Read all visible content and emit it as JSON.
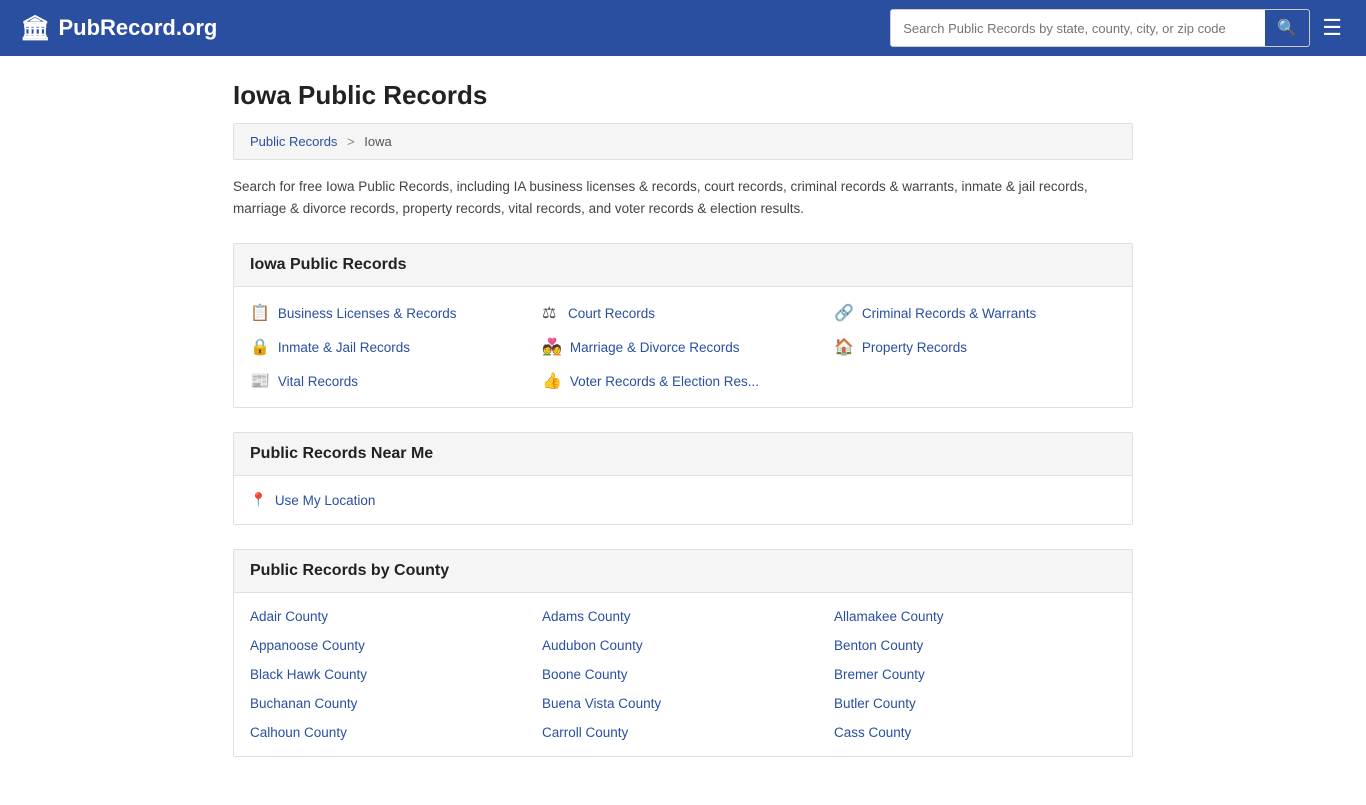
{
  "header": {
    "logo_icon": "🏛",
    "logo_text": "PubRecord.org",
    "search_placeholder": "Search Public Records by state, county, city, or zip code",
    "search_icon": "🔍",
    "menu_icon": "☰"
  },
  "page": {
    "title": "Iowa Public Records",
    "breadcrumb": {
      "parent_label": "Public Records",
      "separator": ">",
      "current": "Iowa"
    },
    "description": "Search for free Iowa Public Records, including IA business licenses & records, court records, criminal records & warrants, inmate & jail records, marriage & divorce records, property records, vital records, and voter records & election results."
  },
  "records_section": {
    "heading": "Iowa Public Records",
    "items": [
      {
        "icon": "📋",
        "label": "Business Licenses & Records"
      },
      {
        "icon": "⚖",
        "label": "Court Records"
      },
      {
        "icon": "🔗",
        "label": "Criminal Records & Warrants"
      },
      {
        "icon": "🔒",
        "label": "Inmate & Jail Records"
      },
      {
        "icon": "💑",
        "label": "Marriage & Divorce Records"
      },
      {
        "icon": "🏠",
        "label": "Property Records"
      },
      {
        "icon": "📰",
        "label": "Vital Records"
      },
      {
        "icon": "👍",
        "label": "Voter Records & Election Res..."
      }
    ]
  },
  "near_me_section": {
    "heading": "Public Records Near Me",
    "use_location_icon": "📍",
    "use_location_label": "Use My Location"
  },
  "county_section": {
    "heading": "Public Records by County",
    "counties": [
      "Adair County",
      "Adams County",
      "Allamakee County",
      "Appanoose County",
      "Audubon County",
      "Benton County",
      "Black Hawk County",
      "Boone County",
      "Bremer County",
      "Buchanan County",
      "Buena Vista County",
      "Butler County",
      "Calhoun County",
      "Carroll County",
      "Cass County"
    ]
  }
}
